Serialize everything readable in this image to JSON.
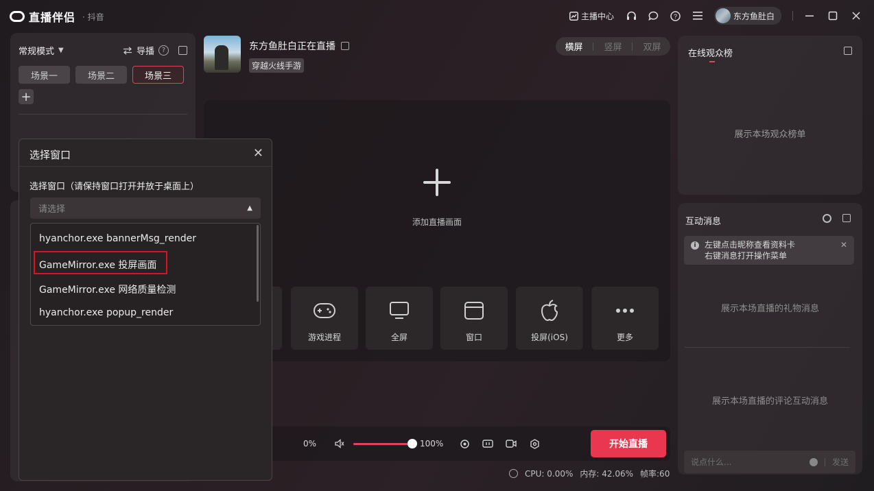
{
  "app": {
    "title": "直播伴侣",
    "subtitle": "· 抖音"
  },
  "titlebar": {
    "anchor_center": "主播中心",
    "user_name": "东方鱼肚白"
  },
  "left_panel": {
    "mode": "常规模式",
    "guide": "导播",
    "scenes": [
      "场景一",
      "场景二",
      "场景三"
    ]
  },
  "stream": {
    "title": "东方鱼肚白正在直播",
    "game_tag": "穿越火线手游",
    "orientation": [
      "横屏",
      "竖屏",
      "双屏"
    ]
  },
  "canvas": {
    "add_label": "添加直播画面",
    "sources": [
      "游戏进程",
      "全屏",
      "窗口",
      "投屏(iOS)",
      "更多"
    ]
  },
  "controls": {
    "mic_percent": "0%",
    "volume_percent": "100%",
    "volume_level": 1.0,
    "start_button": "开始直播"
  },
  "stats": {
    "cpu": "CPU: 0.00%",
    "memory": "内存: 42.06%",
    "fps": "帧率:60"
  },
  "audience": {
    "title": "在线观众榜",
    "empty": "展示本场观众榜单"
  },
  "messages": {
    "title": "互动消息",
    "tip_line1": "左键点击昵称查看资料卡",
    "tip_line2": "右键消息打开操作菜单",
    "gift_empty": "展示本场直播的礼物消息",
    "comment_empty": "展示本场直播的评论互动消息",
    "chat_placeholder": "说点什么...",
    "send": "发送"
  },
  "dialog": {
    "title": "选择窗口",
    "label": "选择窗口（请保持窗口打开并放于桌面上）",
    "placeholder": "请选择",
    "options": [
      "hyanchor.exe bannerMsg_render",
      "GameMirror.exe 投屏画面",
      "GameMirror.exe 网络质量检测",
      "hyanchor.exe popup_render"
    ],
    "highlighted_index": 1
  },
  "colors": {
    "accent": "#e8374f",
    "highlight_box": "#e0101f"
  }
}
